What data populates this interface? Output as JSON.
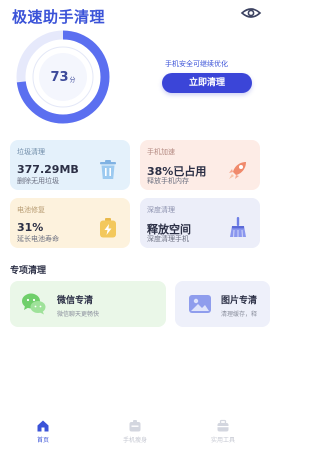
{
  "header": {
    "title": "极速助手清理",
    "eye_icon": "eye-icon"
  },
  "score": {
    "value": "73",
    "unit": "分",
    "progress": 0.73,
    "ring_color": "#5b6ff0"
  },
  "status": {
    "text": "手机安全可继续优化",
    "button_label": "立即清理"
  },
  "cards": {
    "trash": {
      "label": "垃圾清理",
      "value": "377.29MB",
      "sub": "删除无用垃圾",
      "icon": "trash-can-icon"
    },
    "speed": {
      "label": "手机加速",
      "value": "38%已占用",
      "sub": "释放手机内存",
      "icon": "rocket-icon"
    },
    "battery": {
      "label": "电池修复",
      "value": "31%",
      "sub": "延长电池寿命",
      "icon": "battery-bolt-icon"
    },
    "deep": {
      "label": "深度清理",
      "value": "释放空间",
      "sub": "深度清理手机",
      "icon": "broom-icon"
    }
  },
  "section": {
    "title": "专项清理"
  },
  "special": {
    "wechat": {
      "title": "微信专清",
      "sub": "微信聊天更畅快",
      "icon": "wechat-icon"
    },
    "pictures": {
      "title": "图片专清",
      "sub": "清理缓存，释",
      "icon": "picture-icon"
    }
  },
  "tabs": [
    {
      "label": "首页",
      "icon": "home-icon",
      "active": true
    },
    {
      "label": "手机瘦身",
      "icon": "phone-slim-icon",
      "active": false
    },
    {
      "label": "实用工具",
      "icon": "toolbox-icon",
      "active": false
    }
  ],
  "colors": {
    "accent": "#3b53d8",
    "button": "#3b45d8"
  }
}
